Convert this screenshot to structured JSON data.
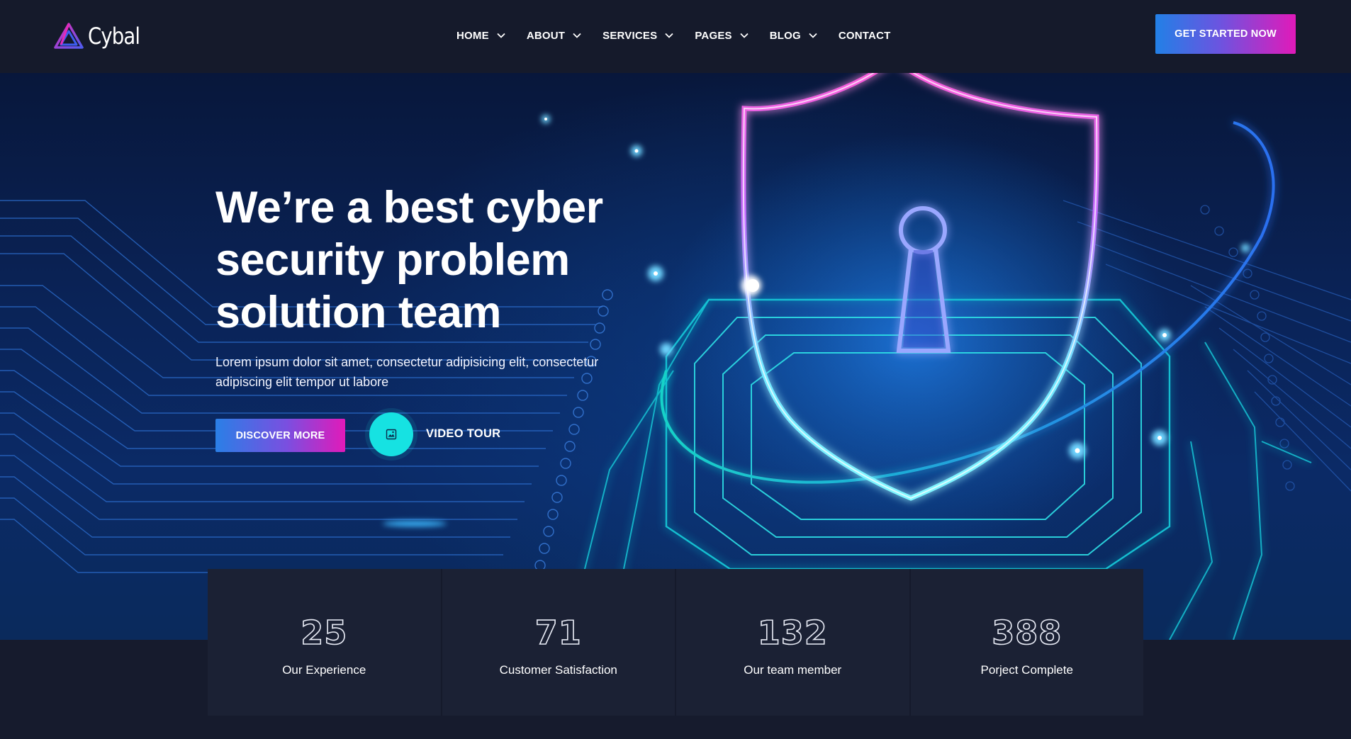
{
  "brand": {
    "name": "Cybal",
    "logo_icon": "triangle-logo-icon"
  },
  "nav": {
    "items": [
      {
        "label": "HOME",
        "has_dropdown": true
      },
      {
        "label": "ABOUT",
        "has_dropdown": true
      },
      {
        "label": "SERVICES",
        "has_dropdown": true
      },
      {
        "label": "PAGES",
        "has_dropdown": true
      },
      {
        "label": "BLOG",
        "has_dropdown": true
      },
      {
        "label": "CONTACT",
        "has_dropdown": false
      }
    ],
    "cta_label": "GET STARTED NOW"
  },
  "hero": {
    "title": "We’re a best cyber\nsecurity problem\nsolution team",
    "description": "Lorem ipsum dolor sit amet, consectetur adipisicing elit, consectetur\nadipiscing elit tempor ut labore",
    "primary_button": "DISCOVER MORE",
    "video_label": "VIDEO TOUR",
    "video_icon": "image-icon"
  },
  "stats": [
    {
      "value": "25",
      "label": "Our Experience"
    },
    {
      "value": "71",
      "label": "Customer Satisfaction"
    },
    {
      "value": "132",
      "label": "Our team member"
    },
    {
      "value": "388",
      "label": "Porject Complete"
    }
  ],
  "colors": {
    "header_bg": "#151a2b",
    "accent_blue": "#2280e6",
    "accent_magenta": "#e11ab9",
    "accent_cyan": "#16e2e2",
    "stat_card_bg": "#1b2134"
  }
}
